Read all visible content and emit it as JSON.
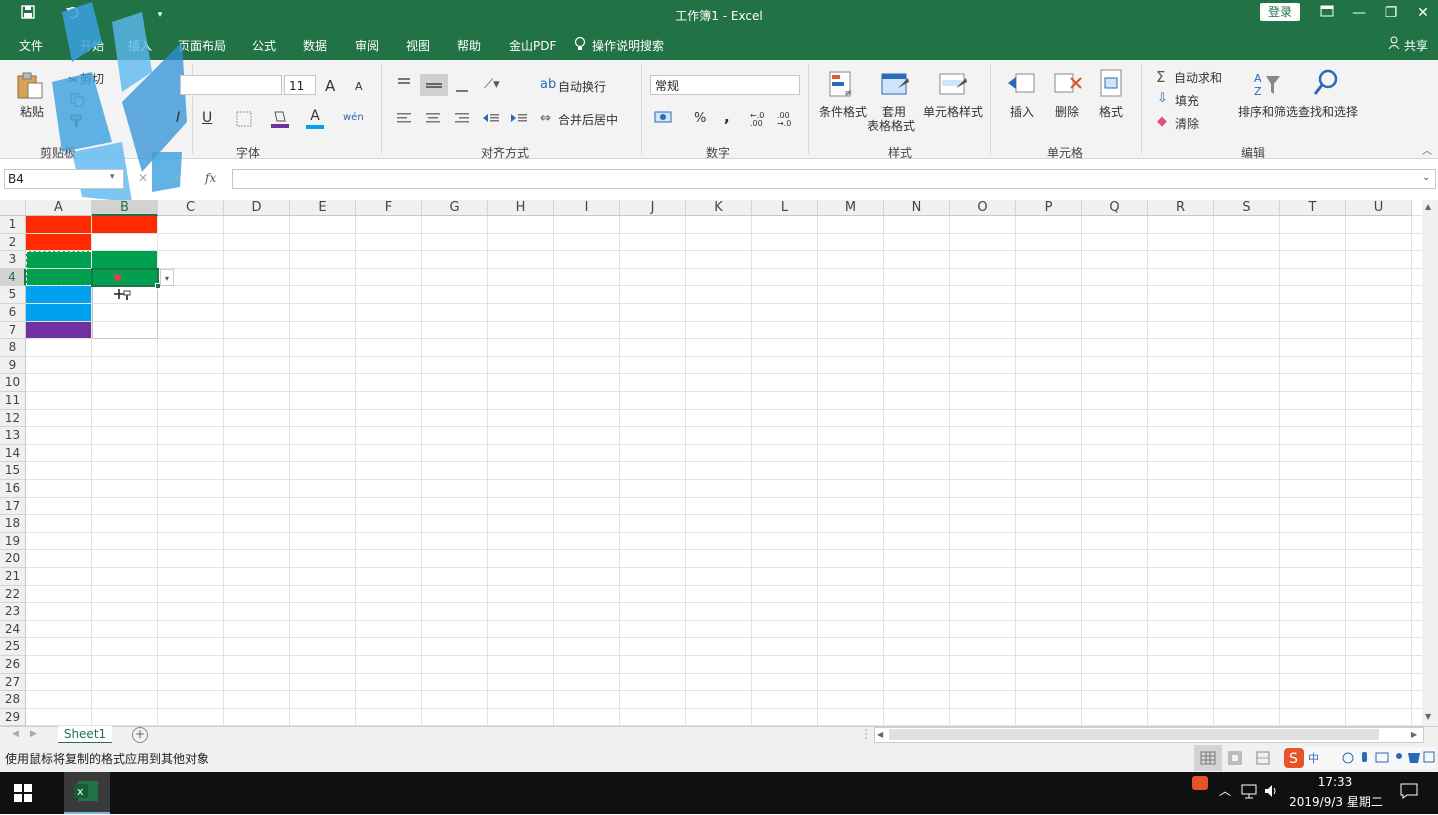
{
  "window": {
    "title": "工作簿1  -  Excel",
    "login_label": "登录",
    "share_label": "共享",
    "save_icon": "save-icon",
    "undo_icon": "undo-icon"
  },
  "tabs": [
    "文件",
    "开始",
    "插入",
    "页面布局",
    "公式",
    "数据",
    "审阅",
    "视图",
    "帮助",
    "金山PDF"
  ],
  "tell_me": "操作说明搜索",
  "ribbon": {
    "clipboard": {
      "paste": "粘贴",
      "cut": "剪切",
      "group": "剪贴板"
    },
    "font": {
      "size": "11",
      "bold": "B",
      "italic": "I",
      "underline": "U",
      "grow": "A",
      "shrink": "A",
      "font_color": "A",
      "phonetic": "wén",
      "group": "字体"
    },
    "align": {
      "wrap": "自动换行",
      "merge": "合并后居中",
      "group": "对齐方式"
    },
    "number": {
      "format": "常规",
      "percent": "%",
      "comma": ",",
      "inc": "←.0 .00",
      "dec": ".00 →.0",
      "group": "数字"
    },
    "styles": {
      "cond": "条件格式",
      "table1": "套用",
      "table2": "表格格式",
      "cell": "单元格样式",
      "group": "样式"
    },
    "cells": {
      "insert": "插入",
      "delete": "删除",
      "format": "格式",
      "group": "单元格"
    },
    "edit": {
      "sum": "自动求和",
      "fill": "填充",
      "clear": "清除",
      "sort": "排序和筛选",
      "find": "查找和选择",
      "group": "编辑"
    }
  },
  "formula_bar": {
    "name_box": "B4",
    "fx": "fx",
    "cancel": "✕",
    "enter": "✓",
    "content": ""
  },
  "grid": {
    "columns": [
      "A",
      "B",
      "C",
      "D",
      "E",
      "F",
      "G",
      "H",
      "I",
      "J",
      "K",
      "L",
      "M",
      "N",
      "O",
      "P",
      "Q",
      "R",
      "S",
      "T",
      "U"
    ],
    "rows": [
      "1",
      "2",
      "3",
      "4",
      "5",
      "6",
      "7",
      "8",
      "9",
      "10",
      "11",
      "12",
      "13",
      "14",
      "15",
      "16",
      "17",
      "18",
      "19",
      "20",
      "21",
      "22",
      "23",
      "24",
      "25",
      "26",
      "27",
      "28",
      "29"
    ],
    "fills": [
      {
        "cell": "A1",
        "color": "#ff2a00"
      },
      {
        "cell": "B1",
        "color": "#ff2a00"
      },
      {
        "cell": "A2",
        "color": "#ff2a00"
      },
      {
        "cell": "A3",
        "color": "#00a050"
      },
      {
        "cell": "B3",
        "color": "#00a050"
      },
      {
        "cell": "A4",
        "color": "#00a050"
      },
      {
        "cell": "B4",
        "color": "#00a050"
      },
      {
        "cell": "A5",
        "color": "#00a2f0"
      },
      {
        "cell": "A6",
        "color": "#00a2f0"
      },
      {
        "cell": "A7",
        "color": "#7030a0"
      }
    ],
    "selected_cell": "B4"
  },
  "sheet_tabs": {
    "active": "Sheet1"
  },
  "status": {
    "message": "使用鼠标将复制的格式应用到其他对象"
  },
  "taskbar": {
    "time": "17:33",
    "date": "2019/9/3 星期二"
  },
  "colors": {
    "brand": "#217346",
    "selection": "#217346"
  }
}
